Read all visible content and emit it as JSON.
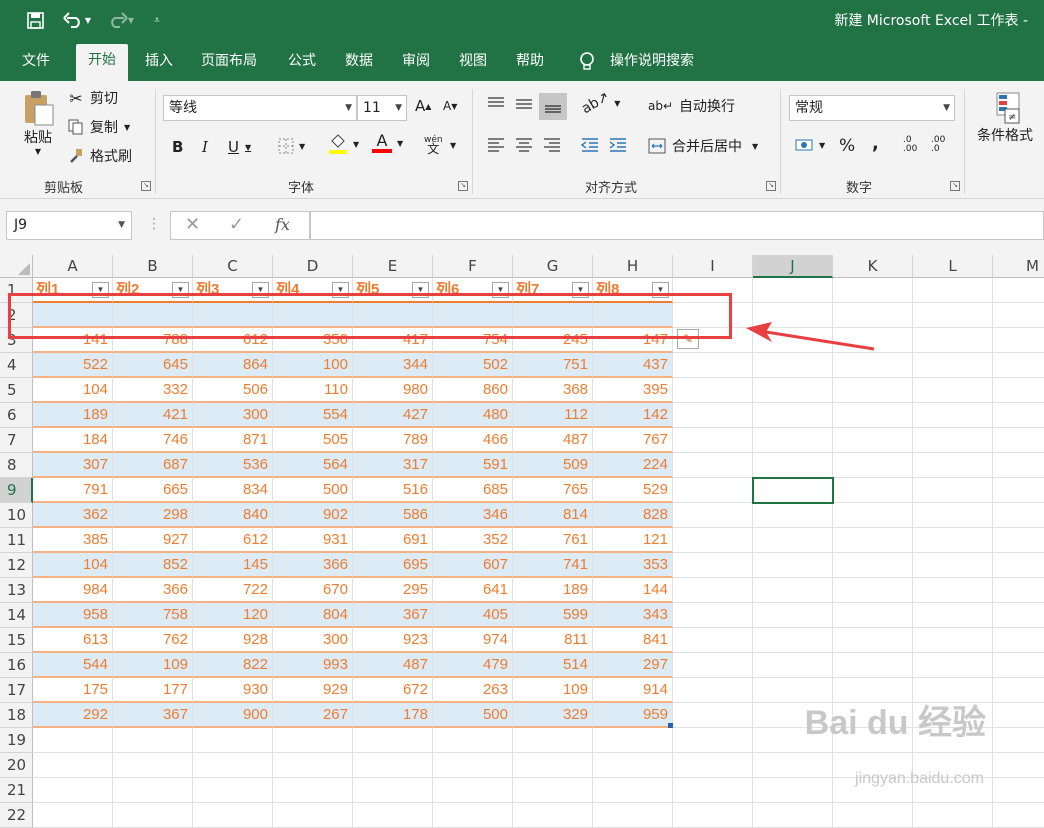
{
  "title": "新建 Microsoft Excel 工作表 -",
  "tabs": [
    "文件",
    "开始",
    "插入",
    "页面布局",
    "公式",
    "数据",
    "审阅",
    "视图",
    "帮助",
    "操作说明搜索"
  ],
  "clipboard": {
    "paste": "粘贴",
    "cut": "剪切",
    "copy": "复制",
    "format_painter": "格式刷",
    "group": "剪贴板"
  },
  "font": {
    "name": "等线",
    "size": "11",
    "group": "字体",
    "pinyin": "wén"
  },
  "alignment": {
    "wrap": "自动换行",
    "merge": "合并后居中",
    "group": "对齐方式"
  },
  "number": {
    "format": "常规",
    "group": "数字",
    "pct": "%",
    "comma": ",",
    "inc": ".0\n.00",
    "dec": ".00\n.0"
  },
  "styles": {
    "conditional": "条件格式"
  },
  "formula_bar": {
    "name_box": "J9",
    "fx": "fx"
  },
  "columns": [
    "A",
    "B",
    "C",
    "D",
    "E",
    "F",
    "G",
    "H",
    "I",
    "J",
    "K",
    "L",
    "M"
  ],
  "rows": [
    "1",
    "2",
    "3",
    "4",
    "5",
    "6",
    "7",
    "8",
    "9",
    "10",
    "11",
    "12",
    "13",
    "14",
    "15",
    "16",
    "17",
    "18",
    "19",
    "20",
    "21",
    "22"
  ],
  "headers": [
    "列1",
    "列2",
    "列3",
    "列4",
    "列5",
    "列6",
    "列7",
    "列8"
  ],
  "data": [
    [
      141,
      788,
      612,
      350,
      417,
      754,
      245,
      147
    ],
    [
      522,
      645,
      864,
      100,
      344,
      502,
      751,
      437
    ],
    [
      104,
      332,
      506,
      110,
      980,
      860,
      368,
      395
    ],
    [
      189,
      421,
      300,
      554,
      427,
      480,
      112,
      142
    ],
    [
      184,
      746,
      871,
      505,
      789,
      466,
      487,
      767
    ],
    [
      307,
      687,
      536,
      564,
      317,
      591,
      509,
      224
    ],
    [
      791,
      665,
      834,
      500,
      516,
      685,
      765,
      529
    ],
    [
      362,
      298,
      840,
      902,
      586,
      346,
      814,
      828
    ],
    [
      385,
      927,
      612,
      931,
      691,
      352,
      761,
      121
    ],
    [
      104,
      852,
      145,
      366,
      695,
      607,
      741,
      353
    ],
    [
      984,
      366,
      722,
      670,
      295,
      641,
      189,
      144
    ],
    [
      958,
      758,
      120,
      804,
      367,
      405,
      599,
      343
    ],
    [
      613,
      762,
      928,
      300,
      923,
      974,
      811,
      841
    ],
    [
      544,
      109,
      822,
      993,
      487,
      479,
      514,
      297
    ],
    [
      175,
      177,
      930,
      929,
      672,
      263,
      109,
      914
    ],
    [
      292,
      367,
      900,
      267,
      178,
      500,
      329,
      959
    ]
  ],
  "colors": {
    "excel_green": "#217346",
    "table_orange": "#ed7d31",
    "band_blue": "#ddebf7",
    "annotation_red": "#e84040"
  },
  "watermark": {
    "brand": "Bai du 经验",
    "url": "jingyan.baidu.com"
  }
}
